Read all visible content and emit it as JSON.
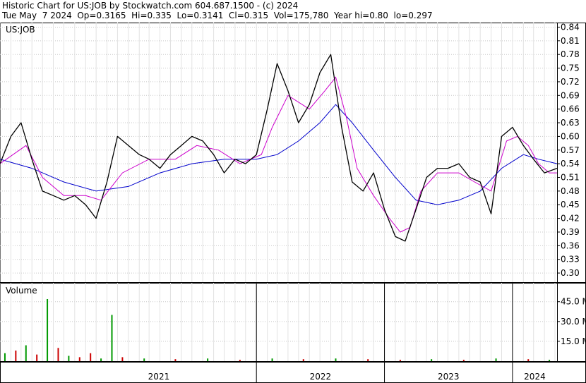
{
  "header": {
    "line1": "Historic Chart for US:JOB by Stockwatch.com 604.687.1500 - (c) 2024",
    "line2": "Tue May  7 2024  Op=0.3165  Hi=0.335  Lo=0.3141  Cl=0.315  Vol=175,780  Year hi=0.80  lo=0.297"
  },
  "chart_data": {
    "type": "line",
    "symbol_label": "US:JOB",
    "volume_label": "Volume",
    "price_axis": {
      "ticks": [
        "0.84",
        "0.81",
        "0.78",
        "0.75",
        "0.72",
        "0.69",
        "0.66",
        "0.63",
        "0.60",
        "0.57",
        "0.54",
        "0.51",
        "0.48",
        "0.45",
        "0.42",
        "0.39",
        "0.36",
        "0.33",
        "0.30"
      ],
      "ylim": [
        0.28,
        0.85
      ]
    },
    "volume_axis": {
      "ticks": [
        "45.0 M",
        "30.0 M",
        "15.0 M"
      ],
      "ylim": [
        0,
        55
      ]
    },
    "x_axis": {
      "range": [
        "2020-01-01",
        "2024-05-07"
      ],
      "year_labels": [
        "2021",
        "2022",
        "2023",
        "2024"
      ],
      "year_boundaries": [
        "2021-05-04",
        "2022-01-01",
        "2023-01-01",
        "2024-01-01"
      ]
    },
    "colors": {
      "price": "#000000",
      "short_ma": "#cc00cc",
      "long_ma": "#0000cc",
      "vol_up": "#009900",
      "vol_down": "#cc0000",
      "grid": "#c8c8c8"
    },
    "price": {
      "x": [
        "2020-01-01",
        "2020-02-01",
        "2020-03-01",
        "2020-04-01",
        "2020-05-01",
        "2020-06-01",
        "2020-07-01",
        "2020-08-01",
        "2020-09-01",
        "2020-10-01",
        "2020-11-01",
        "2020-12-01",
        "2021-01-01",
        "2021-02-01",
        "2021-03-01",
        "2021-04-01",
        "2021-05-01",
        "2021-06-01",
        "2021-07-01",
        "2021-08-01",
        "2021-09-01",
        "2021-10-01",
        "2021-11-01",
        "2021-12-01",
        "2022-01-01",
        "2022-02-01",
        "2022-03-01",
        "2022-04-01",
        "2022-05-01",
        "2022-06-01",
        "2022-07-01",
        "2022-08-01",
        "2022-09-01",
        "2022-10-01",
        "2022-11-01",
        "2022-12-01",
        "2023-01-01",
        "2023-02-01",
        "2023-03-01",
        "2023-04-01",
        "2023-05-01",
        "2023-06-01",
        "2023-07-01",
        "2023-08-01",
        "2023-09-01",
        "2023-10-01",
        "2023-11-01",
        "2023-12-01",
        "2024-01-01",
        "2024-02-01",
        "2024-03-01",
        "2024-04-01",
        "2024-05-07"
      ],
      "y": [
        0.54,
        0.6,
        0.63,
        0.55,
        0.48,
        0.47,
        0.46,
        0.47,
        0.45,
        0.42,
        0.5,
        0.6,
        0.58,
        0.56,
        0.55,
        0.53,
        0.56,
        0.58,
        0.6,
        0.59,
        0.56,
        0.52,
        0.55,
        0.54,
        0.56,
        0.66,
        0.76,
        0.7,
        0.63,
        0.67,
        0.74,
        0.78,
        0.62,
        0.5,
        0.48,
        0.52,
        0.44,
        0.38,
        0.37,
        0.44,
        0.51,
        0.53,
        0.53,
        0.54,
        0.51,
        0.5,
        0.43,
        0.6,
        0.62,
        0.58,
        0.55,
        0.52,
        0.53
      ]
    },
    "short_ma": {
      "x": [
        "2020-01-01",
        "2020-03-15",
        "2020-05-01",
        "2020-07-01",
        "2020-09-01",
        "2020-10-15",
        "2020-12-15",
        "2021-03-01",
        "2021-05-15",
        "2021-07-15",
        "2021-09-15",
        "2021-11-15",
        "2022-01-15",
        "2022-02-15",
        "2022-04-01",
        "2022-06-01",
        "2022-07-15",
        "2022-08-15",
        "2022-09-15",
        "2022-10-15",
        "2022-12-01",
        "2023-01-15",
        "2023-02-15",
        "2023-03-15",
        "2023-04-15",
        "2023-06-01",
        "2023-08-01",
        "2023-09-15",
        "2023-11-01",
        "2023-12-15",
        "2024-01-15",
        "2024-02-15",
        "2024-03-15",
        "2024-04-15",
        "2024-05-07"
      ],
      "y": [
        0.54,
        0.58,
        0.51,
        0.47,
        0.47,
        0.46,
        0.52,
        0.55,
        0.55,
        0.58,
        0.57,
        0.54,
        0.56,
        0.62,
        0.69,
        0.66,
        0.7,
        0.73,
        0.64,
        0.53,
        0.47,
        0.42,
        0.39,
        0.4,
        0.48,
        0.52,
        0.52,
        0.5,
        0.48,
        0.59,
        0.6,
        0.58,
        0.54,
        0.52,
        0.52
      ]
    },
    "long_ma": {
      "x": [
        "2020-01-01",
        "2020-04-01",
        "2020-07-01",
        "2020-10-01",
        "2021-01-01",
        "2021-04-01",
        "2021-07-01",
        "2021-10-01",
        "2022-01-01",
        "2022-03-01",
        "2022-05-01",
        "2022-07-01",
        "2022-08-15",
        "2022-10-01",
        "2022-12-01",
        "2023-02-01",
        "2023-04-01",
        "2023-06-01",
        "2023-08-01",
        "2023-10-01",
        "2023-12-01",
        "2024-02-01",
        "2024-03-15",
        "2024-05-07"
      ],
      "y": [
        0.55,
        0.53,
        0.5,
        0.48,
        0.49,
        0.52,
        0.54,
        0.55,
        0.55,
        0.56,
        0.59,
        0.63,
        0.67,
        0.63,
        0.57,
        0.51,
        0.46,
        0.45,
        0.46,
        0.48,
        0.53,
        0.56,
        0.55,
        0.54
      ]
    },
    "volume": {
      "x": [
        "2020-01-15",
        "2020-02-15",
        "2020-03-15",
        "2020-04-15",
        "2020-05-15",
        "2020-06-15",
        "2020-07-15",
        "2020-08-15",
        "2020-09-15",
        "2020-10-15",
        "2020-11-15",
        "2020-12-15",
        "2021-02-15",
        "2021-05-15",
        "2021-08-15",
        "2021-11-15",
        "2022-02-15",
        "2022-05-15",
        "2022-08-15",
        "2022-11-15",
        "2023-02-15",
        "2023-05-15",
        "2023-08-15",
        "2023-11-15",
        "2024-02-15",
        "2024-04-15"
      ],
      "values": [
        6,
        8,
        12,
        5,
        47,
        10,
        4,
        3,
        6,
        2,
        35,
        3,
        2,
        1.5,
        2,
        1,
        2,
        1.5,
        2,
        1.5,
        1,
        1.5,
        1,
        2,
        1.5,
        1
      ],
      "up": [
        true,
        false,
        true,
        false,
        true,
        false,
        true,
        false,
        false,
        true,
        true,
        false,
        true,
        false,
        true,
        false,
        true,
        false,
        true,
        false,
        false,
        true,
        false,
        true,
        false,
        true
      ]
    }
  }
}
